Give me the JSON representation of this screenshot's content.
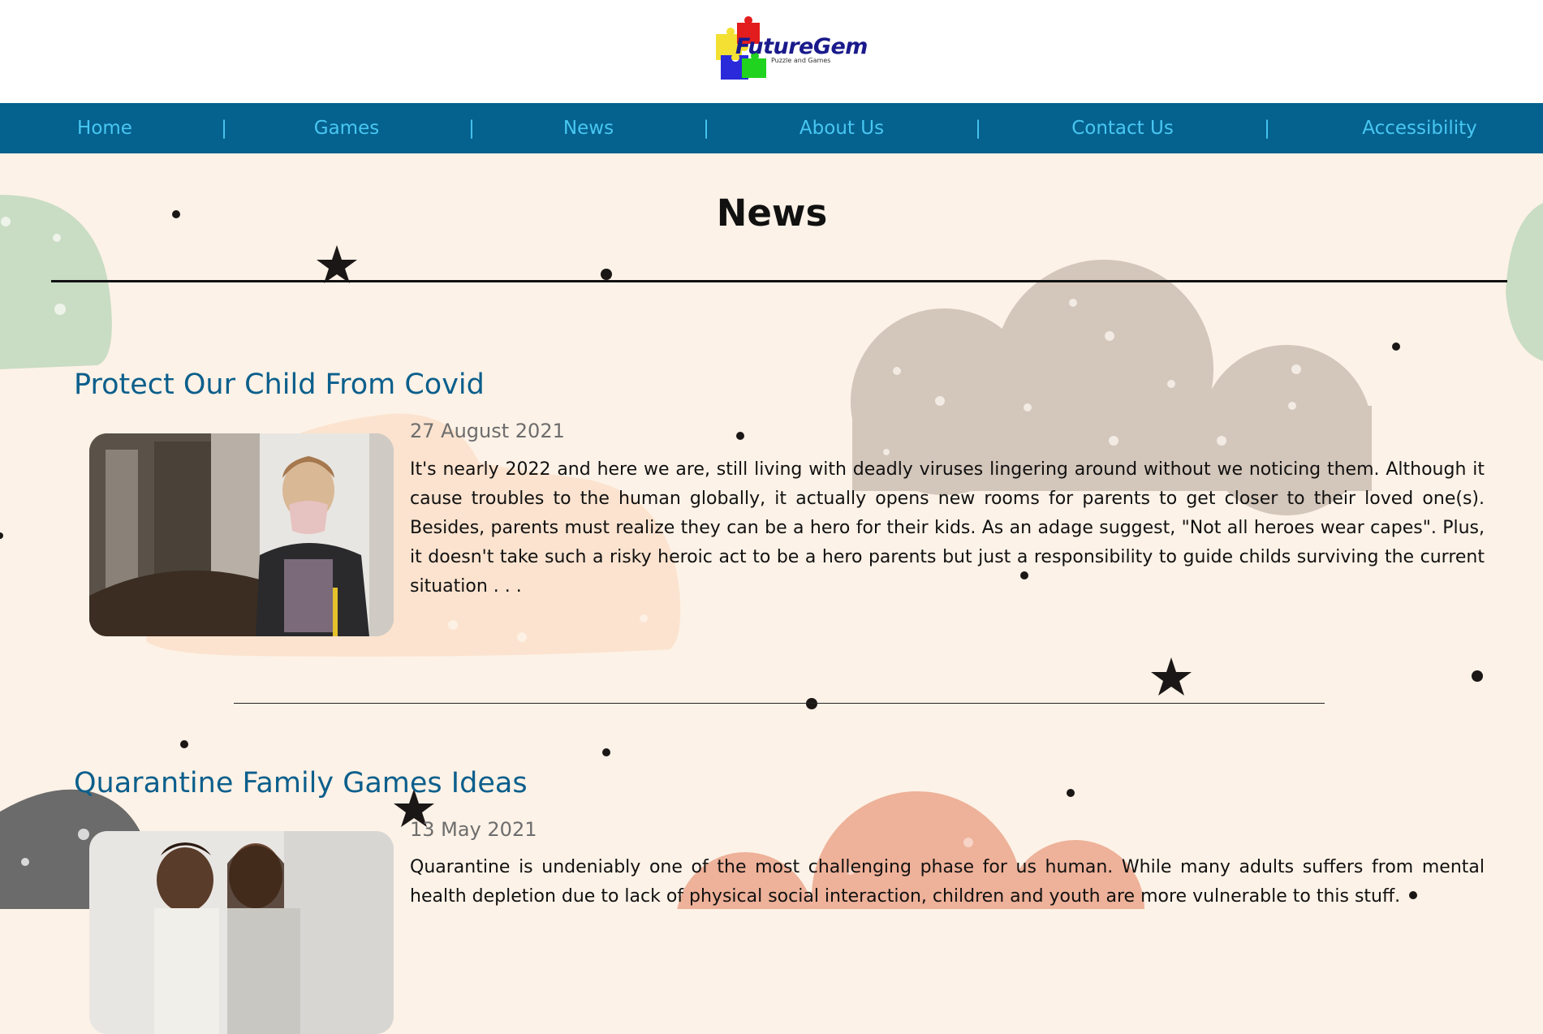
{
  "brand": {
    "logo_text": "FutureGem",
    "tagline": "Puzzle and Games"
  },
  "nav": {
    "items": [
      "Home",
      "Games",
      "News",
      "About Us",
      "Contact Us",
      "Accessibility"
    ],
    "separator": "|"
  },
  "page": {
    "title": "News"
  },
  "articles": [
    {
      "title": "Protect Our Child From Covid",
      "date": "27 August 2021",
      "body": "It's nearly 2022 and here we are, still living with deadly viruses lingering around without we noticing them. Although it cause troubles to the human globally, it actually opens new rooms for parents to get closer to their loved one(s). Besides, parents must realize they can be a hero for their kids. As an adage suggest, \"Not all heroes wear capes\". Plus, it doesn't take such a risky heroic act to be a hero parents but just a responsibility to guide childs surviving the current situation . . ."
    },
    {
      "title": "Quarantine Family Games Ideas",
      "date": "13 May 2021",
      "body": "Quarantine is undeniably one of the most challenging phase for us human. While many adults suffers from mental health depletion due to lack of physical social interaction, children and youth are more vulnerable to this stuff."
    }
  ],
  "colors": {
    "nav_bg": "#05618e",
    "nav_text": "#48c7f2",
    "page_bg": "#fdf2e7",
    "title_blue": "#0b5f8c"
  }
}
